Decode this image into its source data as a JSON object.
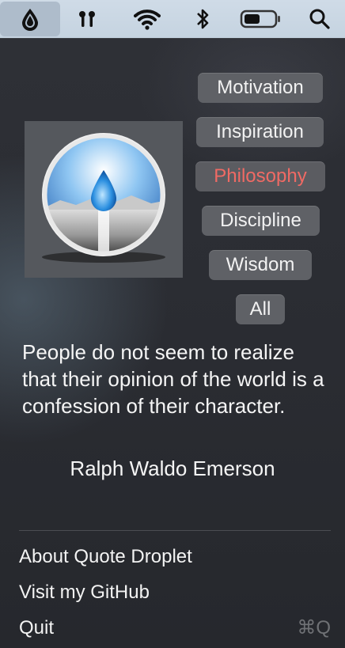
{
  "menubar": {
    "icons": [
      "droplet-icon",
      "airpods-icon",
      "wifi-icon",
      "bluetooth-icon",
      "battery-icon",
      "search-icon"
    ]
  },
  "categories": [
    {
      "label": "Motivation",
      "selected": false
    },
    {
      "label": "Inspiration",
      "selected": false
    },
    {
      "label": "Philosophy",
      "selected": true
    },
    {
      "label": "Discipline",
      "selected": false
    },
    {
      "label": "Wisdom",
      "selected": false
    },
    {
      "label": "All",
      "selected": false
    }
  ],
  "quote": {
    "text": "People do not seem to realize that their opinion of the world is a confession of their character.",
    "author": "Ralph Waldo Emerson"
  },
  "menu": {
    "about": "About Quote Droplet",
    "github": "Visit my GitHub",
    "quit": "Quit",
    "quit_shortcut": "⌘Q"
  },
  "colors": {
    "selected_text": "#f06a64",
    "button_bg": "#5f6166",
    "panel_bg": "#2b2d33"
  }
}
